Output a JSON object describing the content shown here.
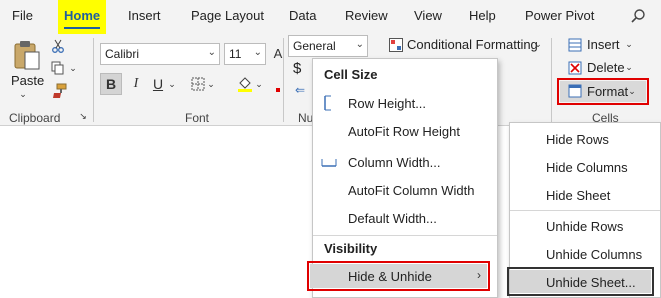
{
  "menubar": {
    "tabs": [
      "File",
      "Home",
      "Insert",
      "Page Layout",
      "Data",
      "Review",
      "View",
      "Help",
      "Power Pivot"
    ],
    "active_tab": "Home"
  },
  "ribbon": {
    "clipboard": {
      "paste_label": "Paste",
      "group_label": "Clipboard"
    },
    "font": {
      "font_name": "Calibri",
      "font_size": "11",
      "bold_label": "B",
      "italic_label": "I",
      "underline_label": "U",
      "group_label": "Font"
    },
    "number": {
      "format_value": "General",
      "currency_symbol": "$",
      "group_label_partial": "Nu"
    },
    "styles": {
      "conditional_formatting_label": "Conditional Formatting"
    },
    "cells": {
      "insert_label": "Insert",
      "delete_label": "Delete",
      "format_label": "Format",
      "group_label": "Cells"
    }
  },
  "format_menu": {
    "cell_size_heading": "Cell Size",
    "row_height": "Row Height...",
    "autofit_row_height": "AutoFit Row Height",
    "column_width": "Column Width...",
    "autofit_column_width": "AutoFit Column Width",
    "default_width": "Default Width...",
    "visibility_heading": "Visibility",
    "hide_unhide": "Hide & Unhide"
  },
  "hide_submenu": {
    "hide_rows": "Hide Rows",
    "hide_columns": "Hide Columns",
    "hide_sheet": "Hide Sheet",
    "unhide_rows": "Unhide Rows",
    "unhide_columns": "Unhide Columns",
    "unhide_sheet": "Unhide Sheet..."
  },
  "colors": {
    "highlight_yellow": "#ffff00",
    "red_outline": "#e00000",
    "accent_blue": "#1f5f9e"
  }
}
